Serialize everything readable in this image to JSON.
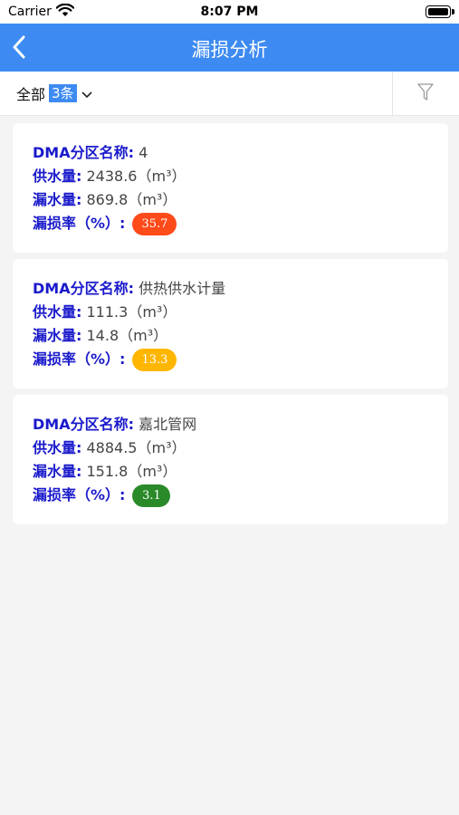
{
  "status": {
    "carrier": "Carrier",
    "time": "8:07 PM"
  },
  "nav": {
    "title": "漏损分析"
  },
  "filter": {
    "scope": "全部",
    "count": "3条"
  },
  "labels": {
    "zone": "DMA分区名称:",
    "supply": "供水量:",
    "leak": "漏水量:",
    "rate": "漏损率（%）:"
  },
  "unit": "（m³）",
  "colors": {
    "nav": "#3d8bf2",
    "high": "#ff4a1a",
    "mid": "#ffb600",
    "low": "#2a8a2a"
  },
  "cards": [
    {
      "zone": "4",
      "supply": "2438.6",
      "leak": "869.8",
      "rate": "35.7",
      "rate_level": "high"
    },
    {
      "zone": "供热供水计量",
      "supply": "111.3",
      "leak": "14.8",
      "rate": "13.3",
      "rate_level": "mid"
    },
    {
      "zone": "嘉北管网",
      "supply": "4884.5",
      "leak": "151.8",
      "rate": "3.1",
      "rate_level": "low"
    }
  ]
}
